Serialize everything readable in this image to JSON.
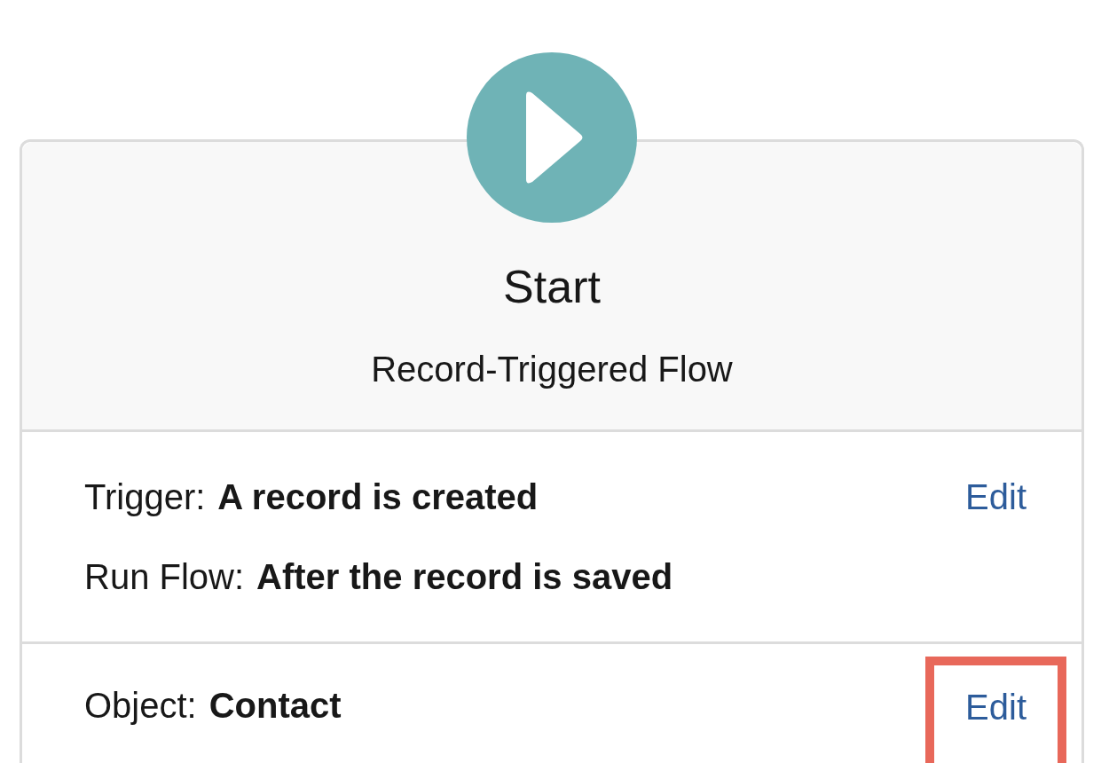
{
  "start": {
    "title": "Start",
    "subtitle": "Record-Triggered Flow"
  },
  "sections": [
    {
      "rows": [
        {
          "label": "Trigger:",
          "value": "A record is created"
        },
        {
          "label": "Run Flow:",
          "value": "After the record is saved"
        }
      ],
      "action": {
        "label": "Edit",
        "highlighted": false
      }
    },
    {
      "rows": [
        {
          "label": "Object:",
          "value": "Contact"
        }
      ],
      "action": {
        "label": "Edit",
        "highlighted": true
      }
    }
  ]
}
